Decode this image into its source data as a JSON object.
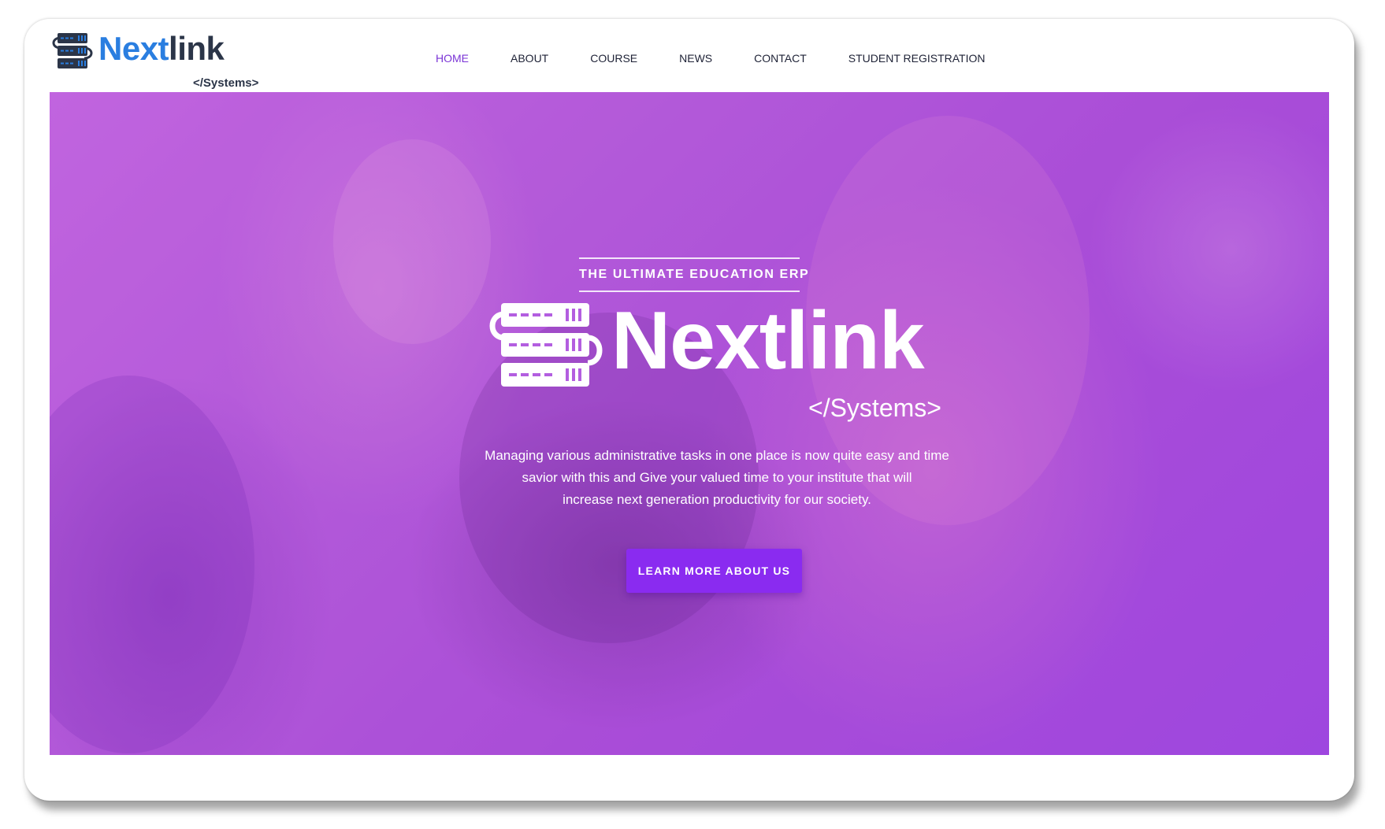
{
  "brand": {
    "name_part1": "Next",
    "name_part2": "link",
    "subtitle": "</Systems>",
    "colors": {
      "blue": "#2a7ee0",
      "dark": "#2b3548",
      "accent": "#8a2bf0",
      "nav_active": "#7b35d6"
    }
  },
  "nav": {
    "items": [
      {
        "label": "HOME",
        "active": true
      },
      {
        "label": "ABOUT",
        "active": false
      },
      {
        "label": "COURSE",
        "active": false
      },
      {
        "label": "NEWS",
        "active": false
      },
      {
        "label": "CONTACT",
        "active": false
      },
      {
        "label": "STUDENT REGISTRATION",
        "active": false
      }
    ]
  },
  "hero": {
    "tagline": "THE ULTIMATE EDUCATION ERP",
    "logo_name": "Nextlink",
    "logo_subtitle": "</Systems>",
    "description_lines": [
      "Managing various administrative tasks in one place is now quite easy and time",
      "savior with this  and Give your valued time to your institute that will",
      "increase next generation productivity for our society."
    ],
    "cta_label": "LEARN MORE ABOUT US"
  }
}
